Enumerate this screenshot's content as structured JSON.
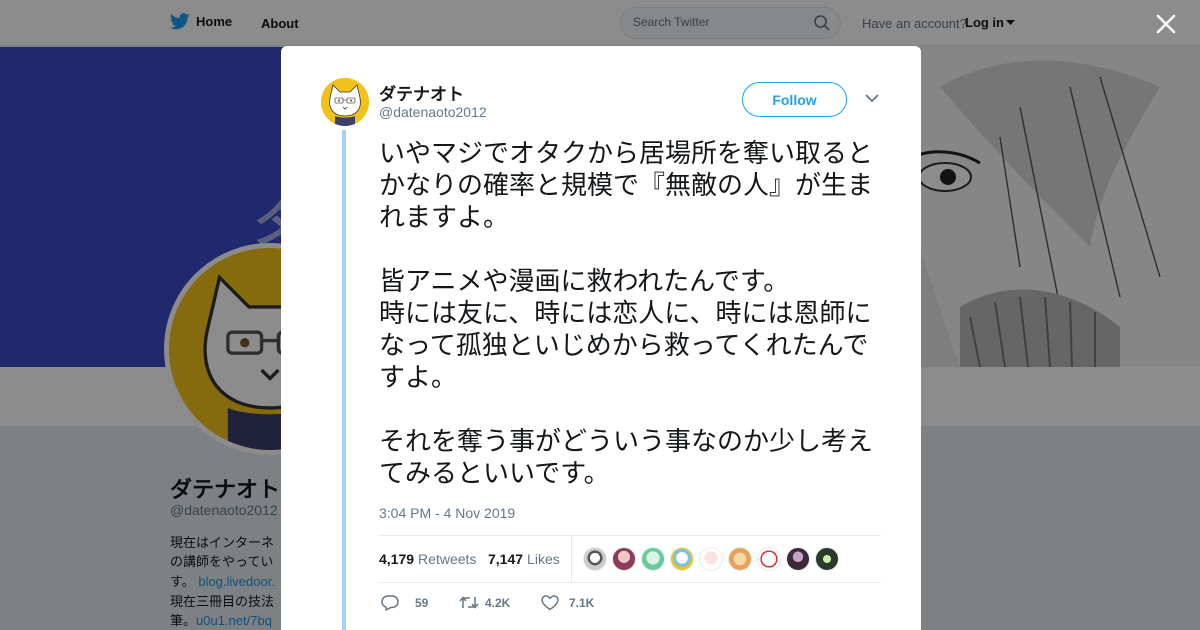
{
  "topbar": {
    "home_label": "Home",
    "about_label": "About",
    "search_placeholder": "Search Twitter",
    "have_account": "Have an account?",
    "login_label": "Log in"
  },
  "profile": {
    "name": "ダテナオト",
    "handle": "@datenaoto2012",
    "bio_lines": [
      "現在はインターネ",
      "の講師をやってい",
      "す。",
      "現在三冊目の技法",
      "筆。"
    ],
    "bio_links": [
      "blog.livedoor.",
      "u0u1.net/7bq"
    ]
  },
  "tweet": {
    "author_name": "ダテナオト",
    "author_handle": "@datenaoto2012",
    "follow_label": "Follow",
    "text": "いやマジでオタクから居場所を奪い取るとかなりの確率と規模で『無敵の人』が生まれますよ。\n\n皆アニメや漫画に救われたんです。\n時には友に、時には恋人に、時には恩師になって孤独といじめから救ってくれたんですよ。\n\nそれを奪う事がどういう事なのか少し考えてみるといいです。",
    "timestamp": "3:04 PM - 4 Nov 2019",
    "retweets_count": "4,179",
    "retweets_label": "Retweets",
    "likes_count": "7,147",
    "likes_label": "Likes",
    "replies": "59",
    "retweets_short": "4.2K",
    "likes_short": "7.1K"
  },
  "colors": {
    "accent": "#1da1f2",
    "banner": "#3b49c9",
    "thread_line": "#a6d4f2"
  },
  "icons": [
    "twitter-bird-icon",
    "search-icon",
    "caret-down-icon",
    "close-icon",
    "chevron-down-icon",
    "reply-icon",
    "retweet-icon",
    "like-icon"
  ]
}
